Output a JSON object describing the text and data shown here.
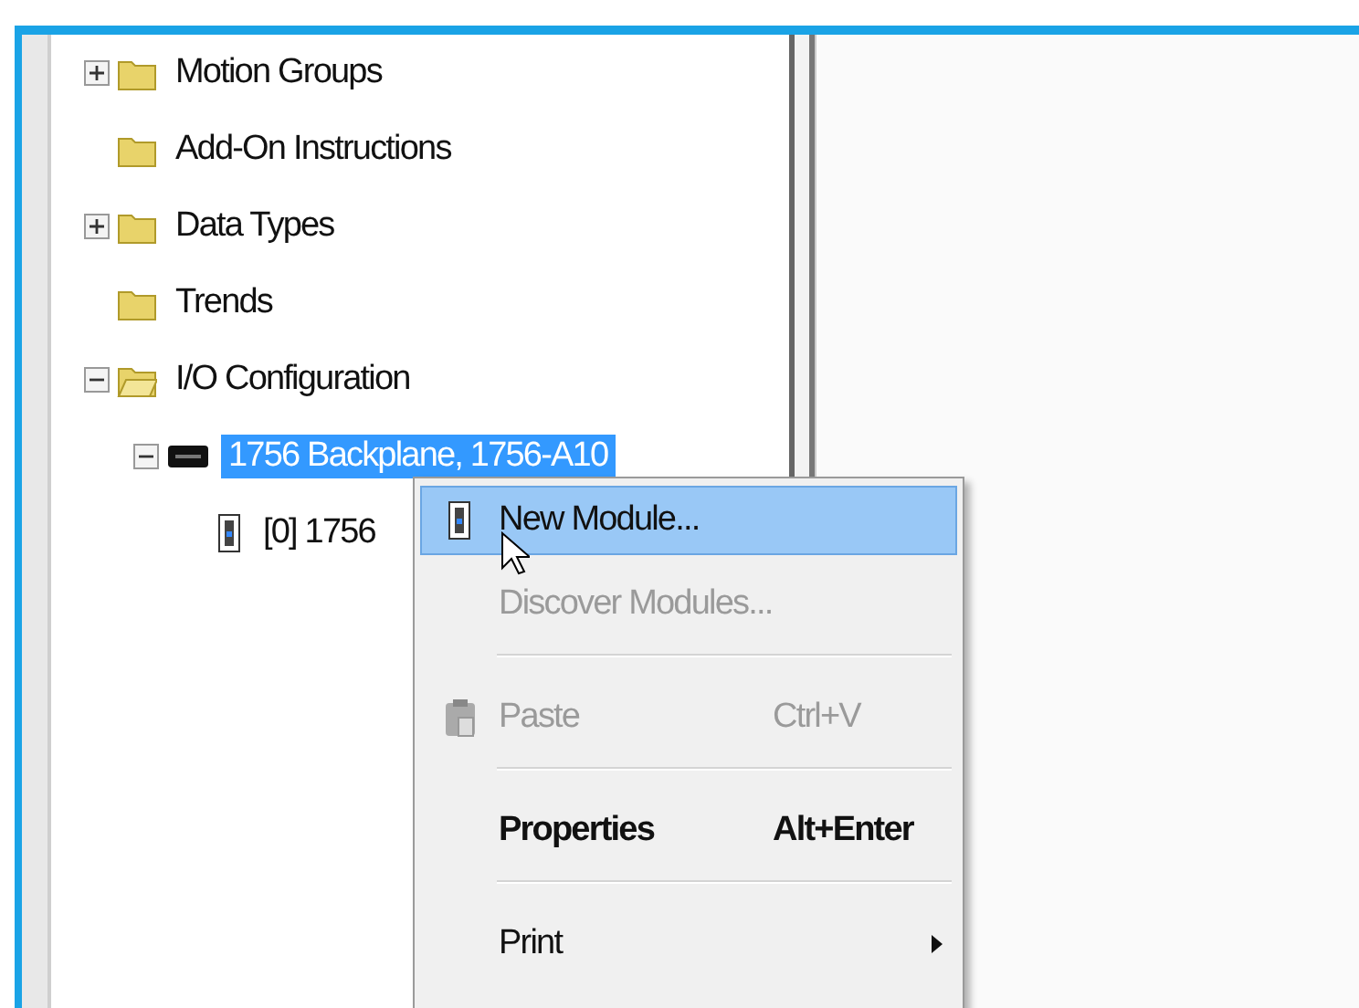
{
  "tree": [
    {
      "label": "Motion Groups",
      "kind": "folder",
      "expanded": false,
      "selected": false
    },
    {
      "label": "Add-On Instructions",
      "kind": "folder",
      "selected": false
    },
    {
      "label": "Data Types",
      "kind": "folder",
      "expanded": false,
      "selected": false
    },
    {
      "label": "Trends",
      "kind": "folder",
      "selected": false
    },
    {
      "label": "I/O Configuration",
      "kind": "folder",
      "expanded": true,
      "selected": false,
      "children": [
        {
          "label": "1756 Backplane, 1756-A10",
          "kind": "backplane",
          "expanded": true,
          "selected": true,
          "children": [
            {
              "label": "[0] 1756",
              "kind": "module",
              "selected": false
            }
          ]
        }
      ]
    }
  ],
  "context_menu": [
    {
      "kind": "item",
      "label": "New Module...",
      "selected": true,
      "disabled": false,
      "default": false
    },
    {
      "kind": "item",
      "label": "Discover Modules...",
      "selected": false,
      "disabled": true,
      "default": false
    },
    {
      "kind": "separator"
    },
    {
      "kind": "item",
      "label": "Paste",
      "shortcut": "Ctrl+V",
      "selected": false,
      "disabled": true,
      "default": false
    },
    {
      "kind": "separator"
    },
    {
      "kind": "item",
      "label": "Properties",
      "shortcut": "Alt+Enter",
      "selected": false,
      "disabled": false,
      "default": true
    },
    {
      "kind": "separator"
    },
    {
      "kind": "item",
      "label": "Print",
      "selected": false,
      "disabled": false,
      "default": false,
      "submenu": true
    }
  ]
}
